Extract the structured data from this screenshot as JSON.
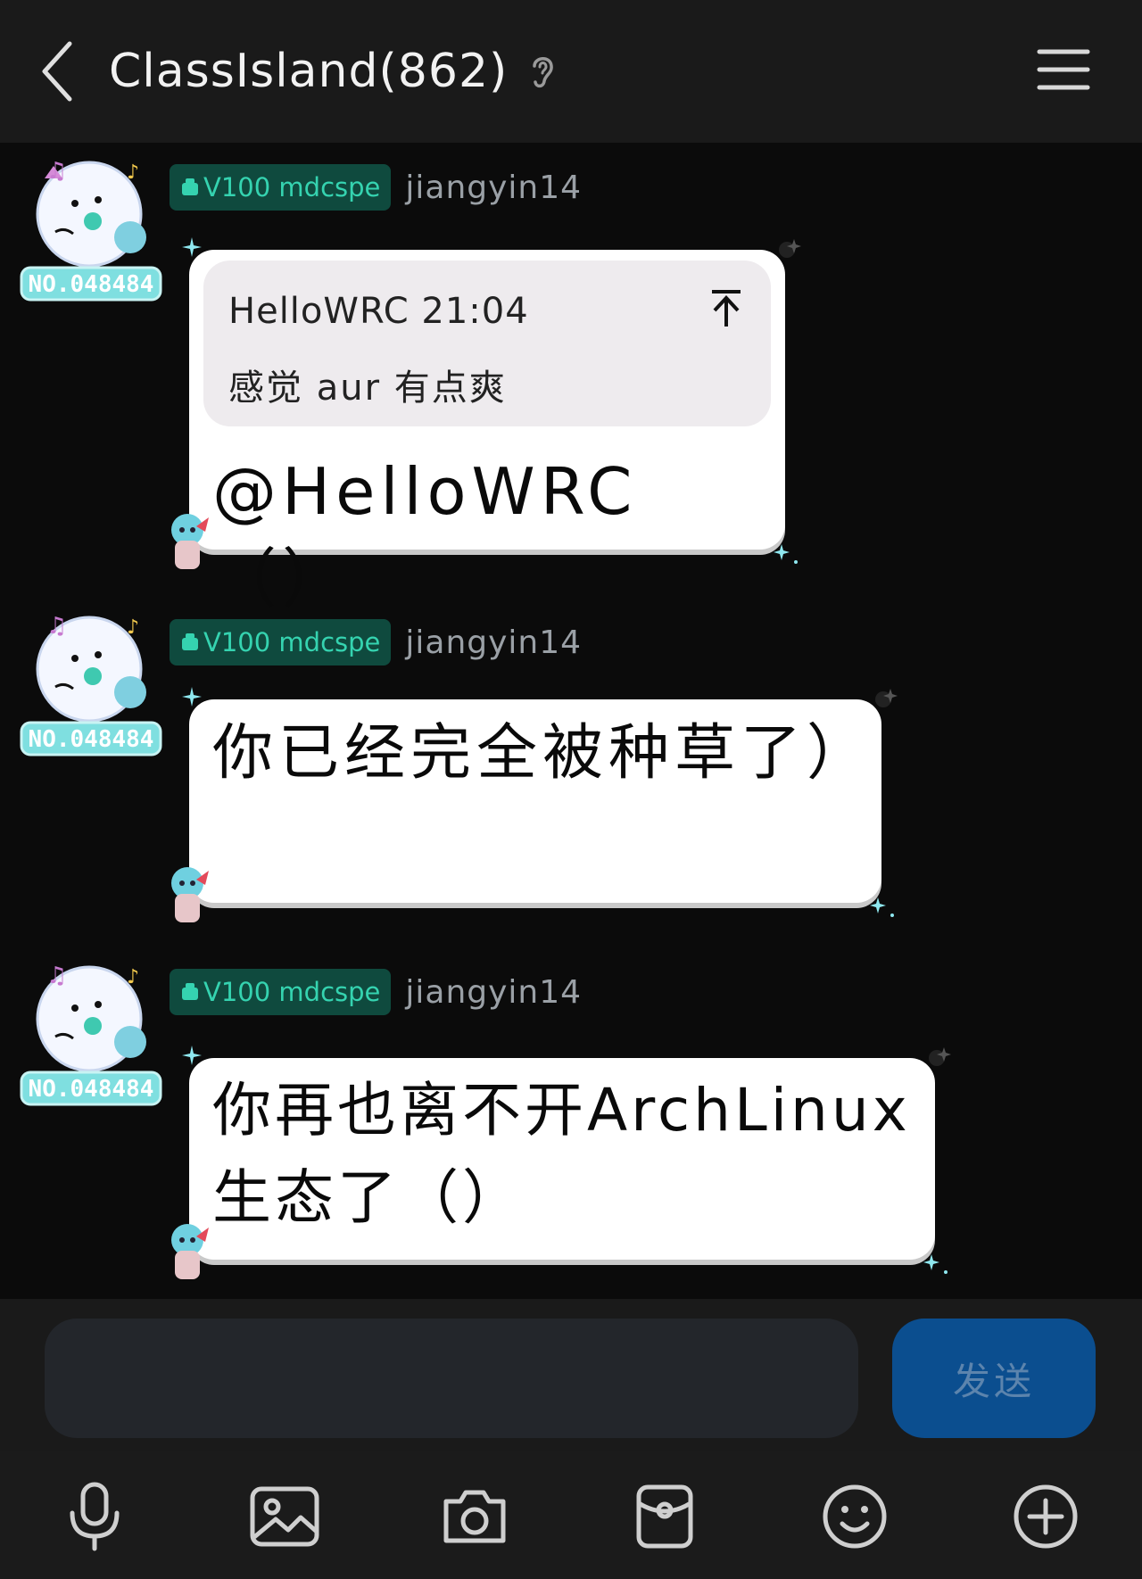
{
  "header": {
    "title": "ClassIsland(862)",
    "back_icon": "chevron-left-icon",
    "listen_icon": "ear-icon",
    "menu_icon": "hamburger-menu-icon"
  },
  "messages": [
    {
      "badge": "V100 mdcspe",
      "sender": "jiangyin14",
      "avatar_label": "NO.048484",
      "quote": {
        "author_time": "HelloWRC 21:04",
        "text": "感觉 aur 有点爽"
      },
      "text": "@HelloWRC （）"
    },
    {
      "badge": "V100 mdcspe",
      "sender": "jiangyin14",
      "avatar_label": "NO.048484",
      "text": "你已经完全被种草了）"
    },
    {
      "badge": "V100 mdcspe",
      "sender": "jiangyin14",
      "avatar_label": "NO.048484",
      "text": "你再也离不开ArchLinux生态了（）"
    }
  ],
  "input": {
    "value": "",
    "placeholder": "",
    "send_label": "发送"
  },
  "toolbar": [
    "microphone-icon",
    "image-icon",
    "camera-icon",
    "red-packet-icon",
    "emoji-icon",
    "plus-icon"
  ],
  "colors": {
    "background": "#0b0b0b",
    "header": "#1a1a1a",
    "badge_bg": "#0f4a3e",
    "badge_text": "#35d3b0",
    "send_button": "#0b4e8f",
    "bubble": "#ffffff"
  }
}
